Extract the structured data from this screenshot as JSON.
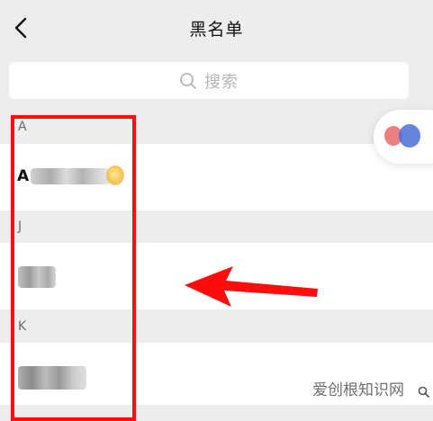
{
  "header": {
    "title": "黑名单",
    "back_icon": "chevron-left-icon"
  },
  "search": {
    "placeholder": "搜索",
    "icon": "search-icon"
  },
  "sections": [
    {
      "letter": "A",
      "contact_initial": "A"
    },
    {
      "letter": "J"
    },
    {
      "letter": "K"
    }
  ],
  "annotation": {
    "box_color": "#ff0d0d",
    "arrow_color": "#ff0d0d"
  },
  "watermark": {
    "text": "爱创根知识网"
  }
}
